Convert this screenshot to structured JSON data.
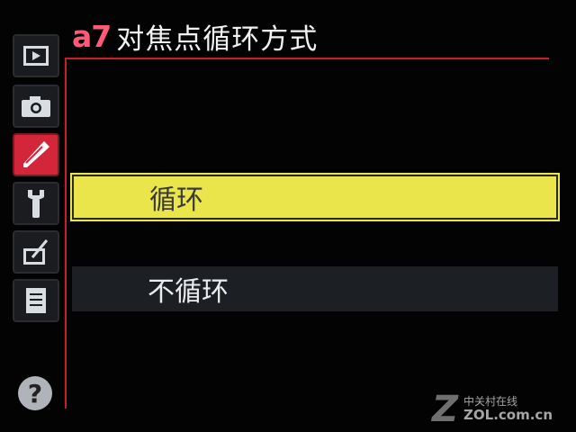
{
  "header": {
    "code": "a7",
    "title": "对焦点循环方式"
  },
  "sidebar": {
    "items": [
      {
        "icon": "play-icon",
        "state": "inactive"
      },
      {
        "icon": "camera-icon",
        "state": "inactive"
      },
      {
        "icon": "pencil-icon",
        "state": "active"
      },
      {
        "icon": "wrench-icon",
        "state": "inactive"
      },
      {
        "icon": "retouch-icon",
        "state": "inactive"
      },
      {
        "icon": "my-menu-icon",
        "state": "inactive"
      }
    ],
    "help_label": "?"
  },
  "menu": {
    "options": [
      {
        "label": "循环",
        "selected": true
      },
      {
        "label": "不循环",
        "selected": false
      }
    ]
  },
  "watermark": {
    "cn": "中关村在线",
    "en": "ZOL.com.cn"
  },
  "colors": {
    "accent": "#d4263a",
    "highlight": "#eae54a",
    "code": "#ff5a78"
  }
}
